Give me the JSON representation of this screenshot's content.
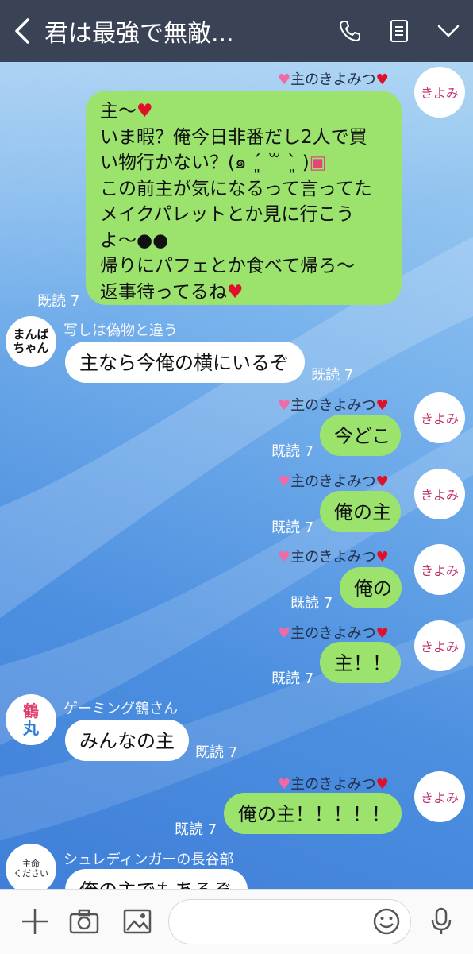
{
  "header": {
    "title": "君は最強で無敵..."
  },
  "sender_self": "主のきよみつ",
  "avatars": {
    "kiyomi": "きよみ",
    "manba": "まんば\nちゃん",
    "tsuru_1": "鶴",
    "tsuru_2": "丸",
    "hasebe_1": "主命",
    "hasebe_2": "ください"
  },
  "messages": [
    {
      "text": "主〜"
    },
    {
      "text": "いま暇？俺今日非番だし2人で買"
    },
    {
      "text": "い物行かない？(๑ ˊ͈ ꒳ ˋ͈ )"
    },
    {
      "text": "この前主が気になるって言ってた"
    },
    {
      "text": "メイクパレットとか見に行こう"
    },
    {
      "text": "よ〜"
    },
    {
      "text": "帰りにパフェとか食べて帰ろ〜"
    },
    {
      "text": "返事待ってるね"
    },
    {
      "sender": "写しは偽物と違う",
      "text": "主なら今俺の横にいるぞ"
    },
    {
      "text": "今どこ"
    },
    {
      "text": "俺の主"
    },
    {
      "text": "俺の"
    },
    {
      "text": "主！！"
    },
    {
      "sender": "ゲーミング鶴さん",
      "text": "みんなの主"
    },
    {
      "text": "俺の主！！！！！"
    },
    {
      "sender": "シュレディンガーの長谷部",
      "text": "俺の主でもあるぞ"
    }
  ],
  "read_label": "既読 7",
  "colors": {
    "header": "#3a4256",
    "bubble_green": "#9be36d",
    "bubble_white": "#ffffff"
  },
  "icons": {
    "back": "chevron-left-icon",
    "call": "phone-icon",
    "notes": "notes-icon",
    "menu": "chevron-down-icon",
    "add": "plus-icon",
    "camera": "camera-icon",
    "image": "image-icon",
    "emoji": "emoji-icon",
    "mic": "mic-icon"
  }
}
